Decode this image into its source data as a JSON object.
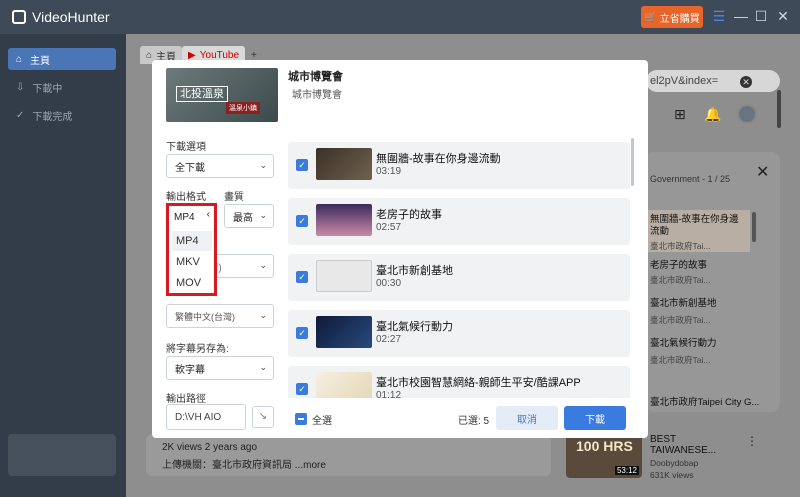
{
  "app": {
    "title": "VideoHunter",
    "buy_label": "立省購買"
  },
  "sidebar": {
    "items": [
      {
        "label": "主頁"
      },
      {
        "label": "下載中"
      },
      {
        "label": "下載完成"
      }
    ]
  },
  "browser": {
    "tabs": [
      {
        "label": "主頁"
      },
      {
        "label": "YouTube"
      },
      {
        "label": "+"
      }
    ],
    "address": "el2pV&index=",
    "playlist": {
      "header": "Government - 1 / 25",
      "items": [
        {
          "title": "無圍牆-故事在你身邊流動",
          "channel": "臺北市政府Tai..."
        },
        {
          "title": "老房子的故事",
          "channel": "臺北市政府Tai..."
        },
        {
          "title": "臺北市新創基地",
          "channel": "臺北市政府Tai..."
        },
        {
          "title": "臺北氣候行動力",
          "channel": "臺北市政府Tai..."
        }
      ],
      "gov_label": "臺北市政府Taipei City G..."
    },
    "info": {
      "meta": "2K views  2 years ago",
      "desc": "上傳機關：臺北市政府資訊局 ...more"
    },
    "rec": {
      "title": "BEST TAIWANESE...",
      "channel": "Doobydobap",
      "views": "631K views",
      "duration": "53:12",
      "thumb_text": "100 HRS"
    }
  },
  "modal": {
    "header": {
      "title": "城市博覽會",
      "subtitle": "城市博覽會",
      "thumb_text": "北投溫泉",
      "thumb_sub": "溫泉小鎮"
    },
    "download_option": {
      "label": "下載選項",
      "value": "全下載"
    },
    "output_format": {
      "label": "輸出格式",
      "value": "MP4",
      "options": [
        "MP4",
        "MKV",
        "MOV"
      ]
    },
    "quality": {
      "label": "畫質",
      "value": "最高"
    },
    "audio_select": {
      "value": "(灣)"
    },
    "subtitle_lang": {
      "value": "繁體中文(台灣)"
    },
    "save_sub_as": {
      "label": "將字幕另存為:",
      "value": "軟字幕"
    },
    "output_path": {
      "label": "輸出路徑",
      "value": "D:\\VH AIO"
    },
    "videos": [
      {
        "title": "無圍牆-故事在你身邊流動",
        "duration": "03:19"
      },
      {
        "title": "老房子的故事",
        "duration": "02:57"
      },
      {
        "title": "臺北市新創基地",
        "duration": "00:30"
      },
      {
        "title": "臺北氣候行動力",
        "duration": "02:27"
      },
      {
        "title": "臺北市校園智慧網絡-親師生平安/酷課APP",
        "duration": "01:12"
      }
    ],
    "footer": {
      "select_all": "全選",
      "selected": "已選: 5",
      "cancel": "取消",
      "download": "下載"
    }
  }
}
